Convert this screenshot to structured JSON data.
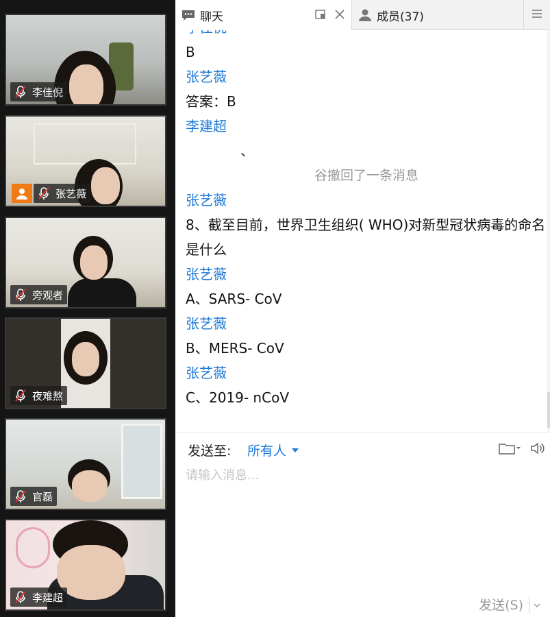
{
  "participants": [
    {
      "name": "李佳倪",
      "muted": true
    },
    {
      "name": "张艺薇",
      "muted": true,
      "avatar_badge": true
    },
    {
      "name": "旁观者",
      "muted": true
    },
    {
      "name": "夜难熬",
      "muted": true
    },
    {
      "name": "官磊",
      "muted": true
    },
    {
      "name": "李建超",
      "muted": true
    }
  ],
  "tabs": {
    "chat_label": "聊天",
    "members_label": "成员(37)"
  },
  "messages": [
    {
      "type": "sender",
      "text": "李佳倪"
    },
    {
      "type": "text",
      "text": "B"
    },
    {
      "type": "sender",
      "text": "张艺薇"
    },
    {
      "type": "text",
      "text": "答案：B"
    },
    {
      "type": "sender",
      "text": "李建超"
    },
    {
      "type": "tick",
      "text": "、"
    },
    {
      "type": "recall",
      "text": "谷撤回了一条消息"
    },
    {
      "type": "sender",
      "text": "张艺薇"
    },
    {
      "type": "text",
      "text": "8、截至目前，世界卫生组织( WHO)对新型冠状病毒的命名是什么"
    },
    {
      "type": "sender",
      "text": "张艺薇"
    },
    {
      "type": "text",
      "text": "A、SARS- CoV"
    },
    {
      "type": "sender",
      "text": "张艺薇"
    },
    {
      "type": "text",
      "text": "B、MERS- CoV"
    },
    {
      "type": "sender",
      "text": "张艺薇"
    },
    {
      "type": "text",
      "text": "C、2019- nCoV"
    }
  ],
  "compose": {
    "send_to_label": "发送至:",
    "recipient": "所有人",
    "placeholder": "请输入消息...",
    "send_label": "发送(S)"
  },
  "colors": {
    "accent_blue": "#1f7ad8",
    "avatar_orange": "#f07b15",
    "muted_red": "#e03030"
  }
}
